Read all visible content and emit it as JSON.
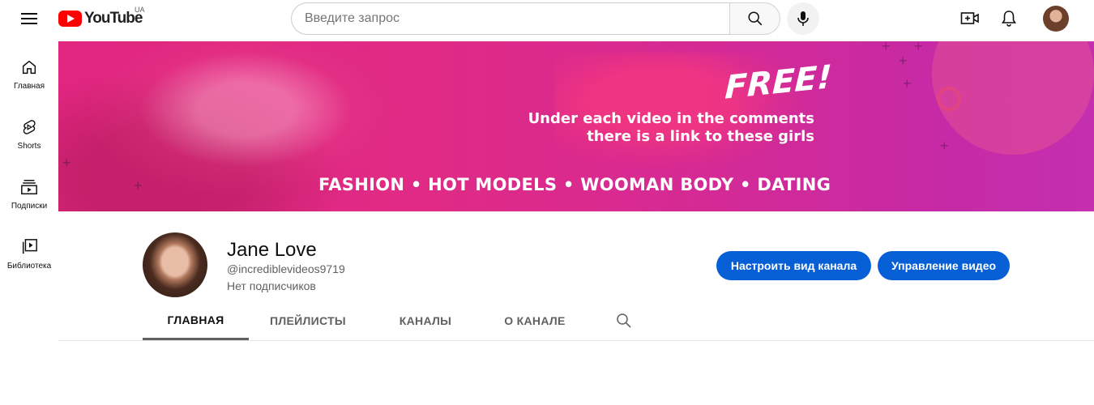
{
  "header": {
    "logo_text": "YouTube",
    "region": "UA",
    "search_placeholder": "Введите запрос",
    "icons": [
      "menu-icon",
      "youtube-logo",
      "search-icon",
      "mic-icon",
      "create-icon",
      "bell-icon",
      "avatar"
    ]
  },
  "sidebar": {
    "items": [
      {
        "label": "Главная",
        "icon": "home-icon"
      },
      {
        "label": "Shorts",
        "icon": "shorts-icon"
      },
      {
        "label": "Подписки",
        "icon": "subscriptions-icon"
      },
      {
        "label": "Библиотека",
        "icon": "library-icon"
      }
    ]
  },
  "banner": {
    "headline": "FREE!",
    "sub_line1": "Under each video in the comments",
    "sub_line2": "there is a link to these girls",
    "categories": "FASHION  •  HOT MODELS  •  WOOMAN BODY  •  DATING",
    "colors": {
      "start": "#e0267f",
      "end": "#c42fb0"
    }
  },
  "channel": {
    "name": "Jane Love",
    "handle": "@incrediblevideos9719",
    "subscribers": "Нет подписчиков",
    "customize_button": "Настроить вид канала",
    "manage_button": "Управление видео",
    "button_color": "#065fd4"
  },
  "tabs": [
    {
      "label": "ГЛАВНАЯ",
      "active": true
    },
    {
      "label": "ПЛЕЙЛИСТЫ",
      "active": false
    },
    {
      "label": "КАНАЛЫ",
      "active": false
    },
    {
      "label": "О КАНАЛЕ",
      "active": false
    }
  ]
}
